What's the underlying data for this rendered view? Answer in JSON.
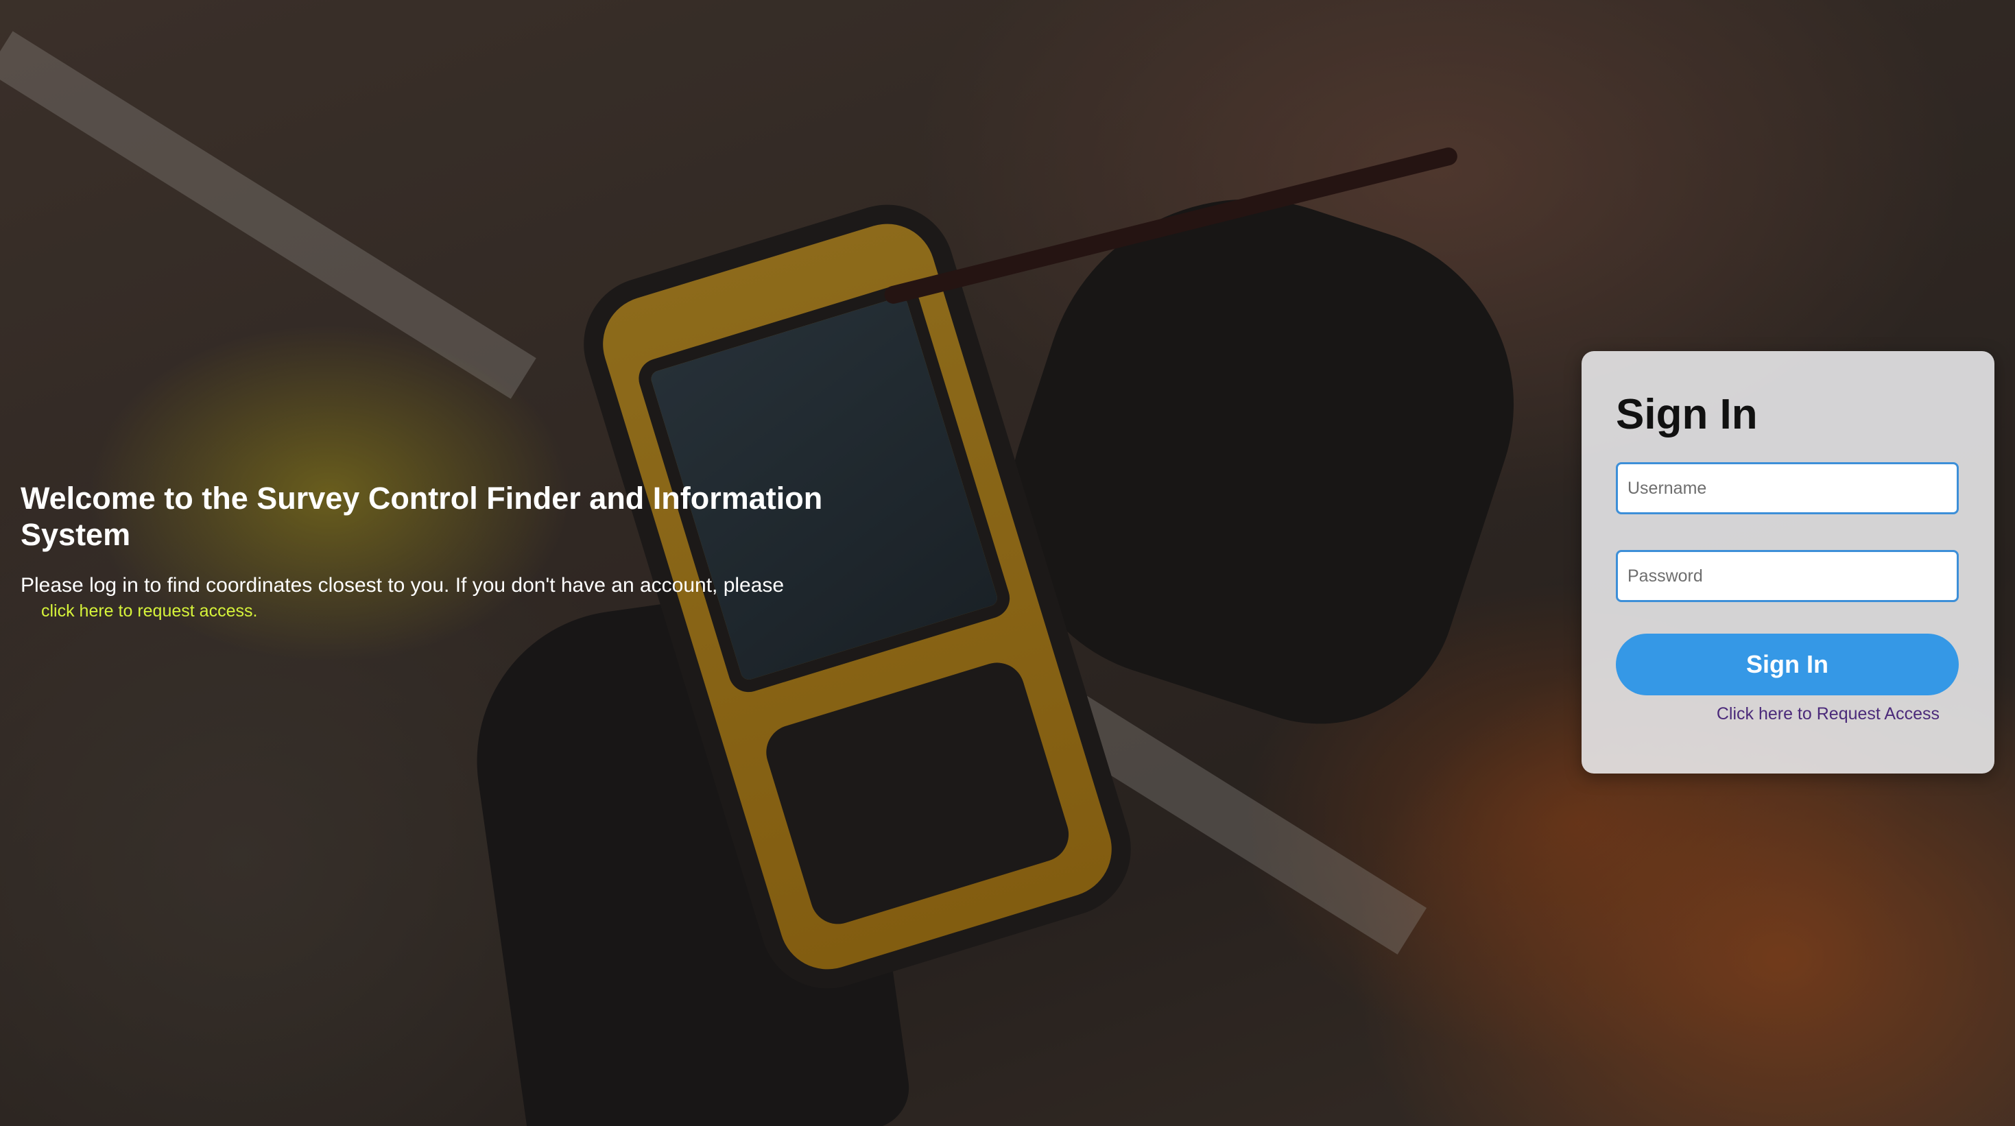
{
  "welcome": {
    "title": "Welcome to the Survey Control Finder and Information System",
    "intro": "Please log in to find coordinates closest to you. If you don't have an account, please",
    "request_link": "click here to request access."
  },
  "signin": {
    "heading": "Sign In",
    "username_placeholder": "Username",
    "password_placeholder": "Password",
    "button_label": "Sign In",
    "request_link": "Click here to Request Access"
  },
  "colors": {
    "accent_button": "#3598e6",
    "input_border": "#3d8fd8",
    "welcome_link": "#d6f33a",
    "card_link": "#4b2a7a"
  },
  "background": {
    "icon": "field-worker-gps-photo"
  }
}
